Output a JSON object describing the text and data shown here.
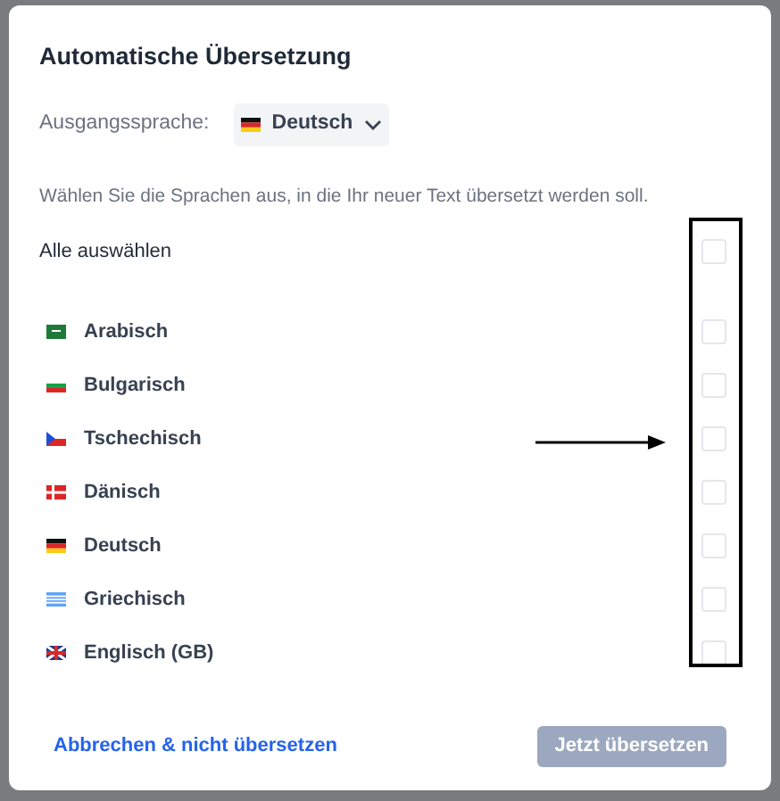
{
  "dialog": {
    "title": "Automatische Übersetzung",
    "source": {
      "label": "Ausgangssprache:",
      "kind": "de",
      "value": "Deutsch"
    },
    "description": "Wählen Sie die Sprachen aus, in die Ihr neuer Text übersetzt werden soll.",
    "select_all": {
      "label": "Alle auswählen",
      "checked": false
    },
    "languages": [
      {
        "kind": "sa",
        "name": "Arabisch",
        "checked": false
      },
      {
        "kind": "bg",
        "name": "Bulgarisch",
        "checked": false
      },
      {
        "kind": "cz",
        "name": "Tschechisch",
        "checked": false
      },
      {
        "kind": "dk",
        "name": "Dänisch",
        "checked": false
      },
      {
        "kind": "de",
        "name": "Deutsch",
        "checked": false
      },
      {
        "kind": "gr",
        "name": "Griechisch",
        "checked": false
      },
      {
        "kind": "gb",
        "name": "Englisch (GB)",
        "checked": false
      }
    ],
    "cancel_link": "Abbrechen & nicht übersetzen",
    "submit_button": {
      "label": "Jetzt übersetzen",
      "disabled": true
    }
  }
}
